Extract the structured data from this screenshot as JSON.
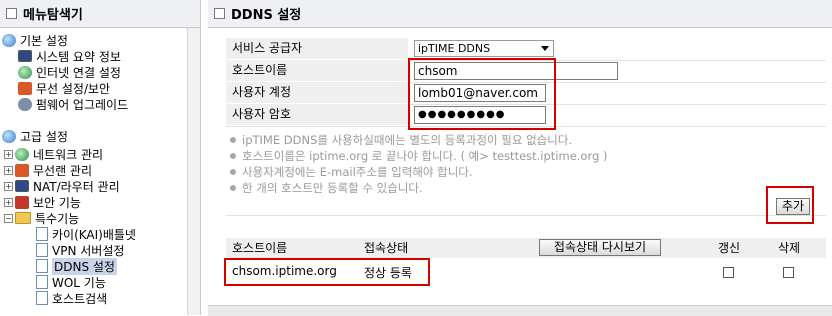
{
  "left_panel": {
    "title": "메뉴탐색기",
    "basic_section": "기본 설정",
    "basic_items": [
      "시스템 요약 정보",
      "인터넷 연결 설정",
      "무선 설정/보안",
      "펌웨어 업그레이드"
    ],
    "advanced_section": "고급 설정",
    "advanced_items": [
      "네트워크 관리",
      "무선랜 관리",
      "NAT/라우터 관리",
      "보안 기능",
      "특수기능"
    ],
    "special_items": [
      "카이(KAI)배틀넷",
      "VPN 서버설정",
      "DDNS 설정",
      "WOL 기능",
      "호스트검색"
    ]
  },
  "right_panel": {
    "title": "DDNS 설정",
    "form": {
      "provider_label": "서비스 공급자",
      "provider_value": "ipTIME DDNS",
      "hostname_label": "호스트이름",
      "hostname_value": "chsom",
      "account_label": "사용자 계정",
      "account_value": "lomb01@naver.com",
      "password_label": "사용자 암호",
      "password_value": "●●●●●●●●●"
    },
    "notes": [
      "ipTIME DDNS를 사용하실때에는 별도의 등록과정이 필요 없습니다.",
      "호스트이름은 iptime.org 로 끝나야 합니다. ( 예> testtest.iptime.org )",
      "사용자계정에는 E-mail주소를 입력해야 합니다.",
      "한 개의 호스트만 등록할 수 있습니다."
    ],
    "add_button": "추가",
    "table": {
      "col_host": "호스트이름",
      "col_status": "접속상태",
      "refresh_button": "접속상태 다시보기",
      "col_renew": "갱신",
      "col_delete": "삭제",
      "rows": [
        {
          "host": "chsom.iptime.org",
          "status": "정상 등록"
        }
      ]
    }
  },
  "colors": {
    "highlight_red": "#d40000",
    "header_bg": "#eef0f3",
    "selected_bg": "#c8d4e8"
  }
}
